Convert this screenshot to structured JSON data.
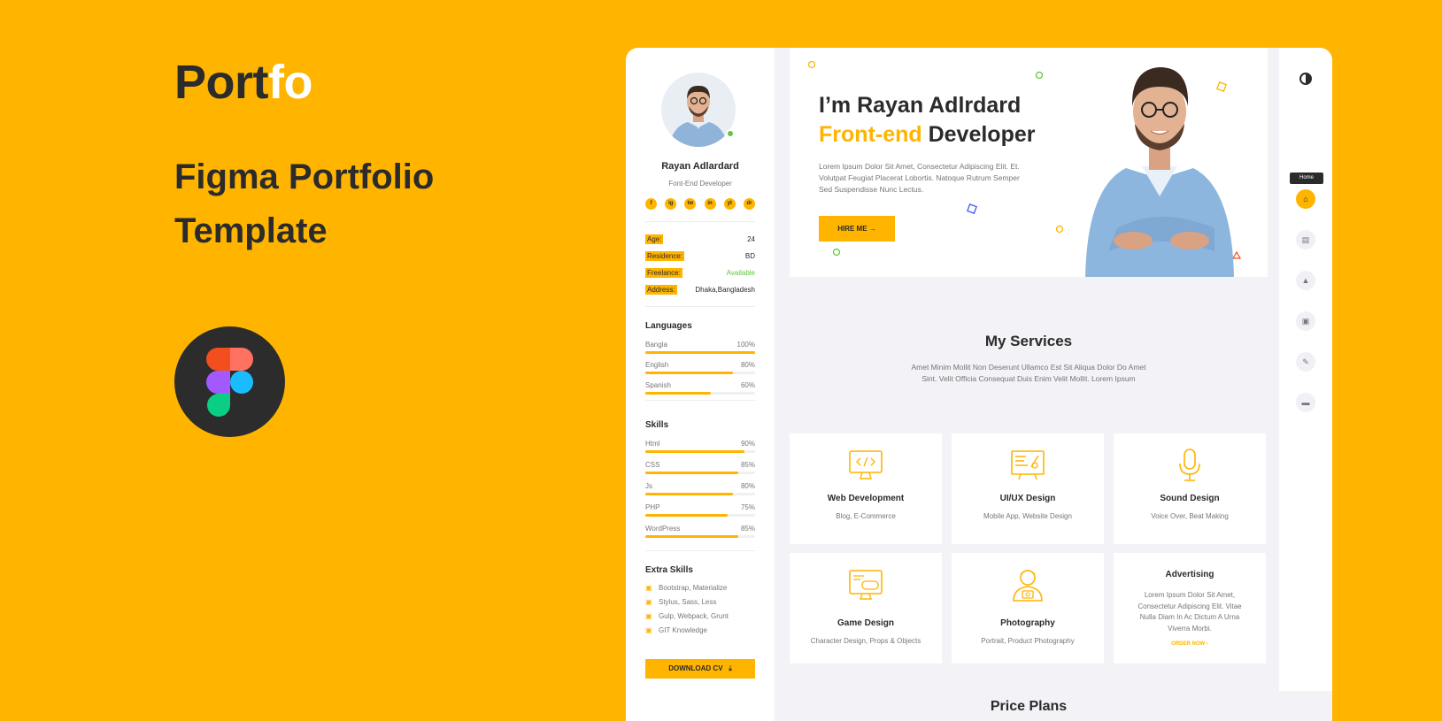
{
  "promo": {
    "brand_dark": "Port",
    "brand_light": "fo",
    "title_line1": "Figma Portfolio",
    "title_line2": "Template"
  },
  "sidebar": {
    "name": "Rayan Adlardard",
    "role": "Font-End Developer",
    "socials": [
      "f",
      "ig",
      "tw",
      "in",
      "yt",
      "dr"
    ],
    "info": [
      {
        "key": "Age:",
        "value": "24"
      },
      {
        "key": "Residence:",
        "value": "BD"
      },
      {
        "key": "Freelance:",
        "value": "Available"
      },
      {
        "key": "Address:",
        "value": "Dhaka,Bangladesh"
      }
    ],
    "languages_heading": "Languages",
    "languages": [
      {
        "name": "Bangla",
        "label": "100%",
        "level": 100
      },
      {
        "name": "English",
        "label": "80%",
        "level": 80
      },
      {
        "name": "Spanish",
        "label": "60%",
        "level": 60
      }
    ],
    "skills_heading": "Skills",
    "skills": [
      {
        "name": "Html",
        "label": "90%",
        "level": 90
      },
      {
        "name": "CSS",
        "label": "85%",
        "level": 85
      },
      {
        "name": "Js",
        "label": "80%",
        "level": 80
      },
      {
        "name": "PHP",
        "label": "75%",
        "level": 75
      },
      {
        "name": "WordPress",
        "label": "85%",
        "level": 85
      }
    ],
    "extra_heading": "Extra Skills",
    "extra": [
      "Bootstrap, Materialize",
      "Stylus, Sass, Less",
      "Gulp, Webpack, Grunt",
      "GIT Knowledge"
    ],
    "download_label": "DOWNLOAD CV",
    "download_icon": "⤓"
  },
  "hero": {
    "greeting": "I’m Rayan Adlrdard",
    "role_highlight": "Front-end",
    "role_rest": " Developer",
    "description": "Lorem Ipsum Dolor Sit Amet, Consectetur Adipiscing Elit. Et. Volutpat Feugiat Placerat Lobortis. Natoque Rutrum Semper Sed Suspendisse Nunc Lectus.",
    "hire_label": "HIRE ME →"
  },
  "services": {
    "title": "My Services",
    "description": "Amet Minim Mollit Non Deserunt Ullamco Est Sit Aliqua Dolor Do Amet Sint. Velit Officia Consequat Duis Enim Velit Mollit. Lorem Ipsum",
    "items": [
      {
        "title": "Web Development",
        "subtitle": "Blog, E-Commerce",
        "icon": "monitor-code-icon"
      },
      {
        "title": "UI/UX Design",
        "subtitle": "Mobile App, Website Design",
        "icon": "design-board-icon"
      },
      {
        "title": "Sound Design",
        "subtitle": "Voice Over, Beat Making",
        "icon": "microphone-icon"
      },
      {
        "title": "Game Design",
        "subtitle": "Character Design, Props & Objects",
        "icon": "gamepad-monitor-icon"
      },
      {
        "title": "Photography",
        "subtitle": "Portrait, Product Photography",
        "icon": "photographer-icon"
      },
      {
        "title": "Advertising",
        "description": "Lorem Ipsum Dolor Sit Amet, Consectetur Adipiscing Elit. Vitae Nulla Diam In Ac Dictum A Urna Viverra Morbi.",
        "cta": "ORDER NOW ›"
      }
    ]
  },
  "price": {
    "title": "Price Plans"
  },
  "nav": {
    "tooltip": "Home",
    "items": [
      "home-icon",
      "portfolio-icon",
      "education-icon",
      "work-icon",
      "blog-icon",
      "contact-icon"
    ],
    "glyphs": [
      "⌂",
      "▤",
      "▲",
      "▣",
      "✎",
      "▬"
    ]
  },
  "colors": {
    "accent": "#FFB400",
    "dark": "#2B2B2B",
    "muted": "#767676",
    "green": "#63C53B"
  }
}
